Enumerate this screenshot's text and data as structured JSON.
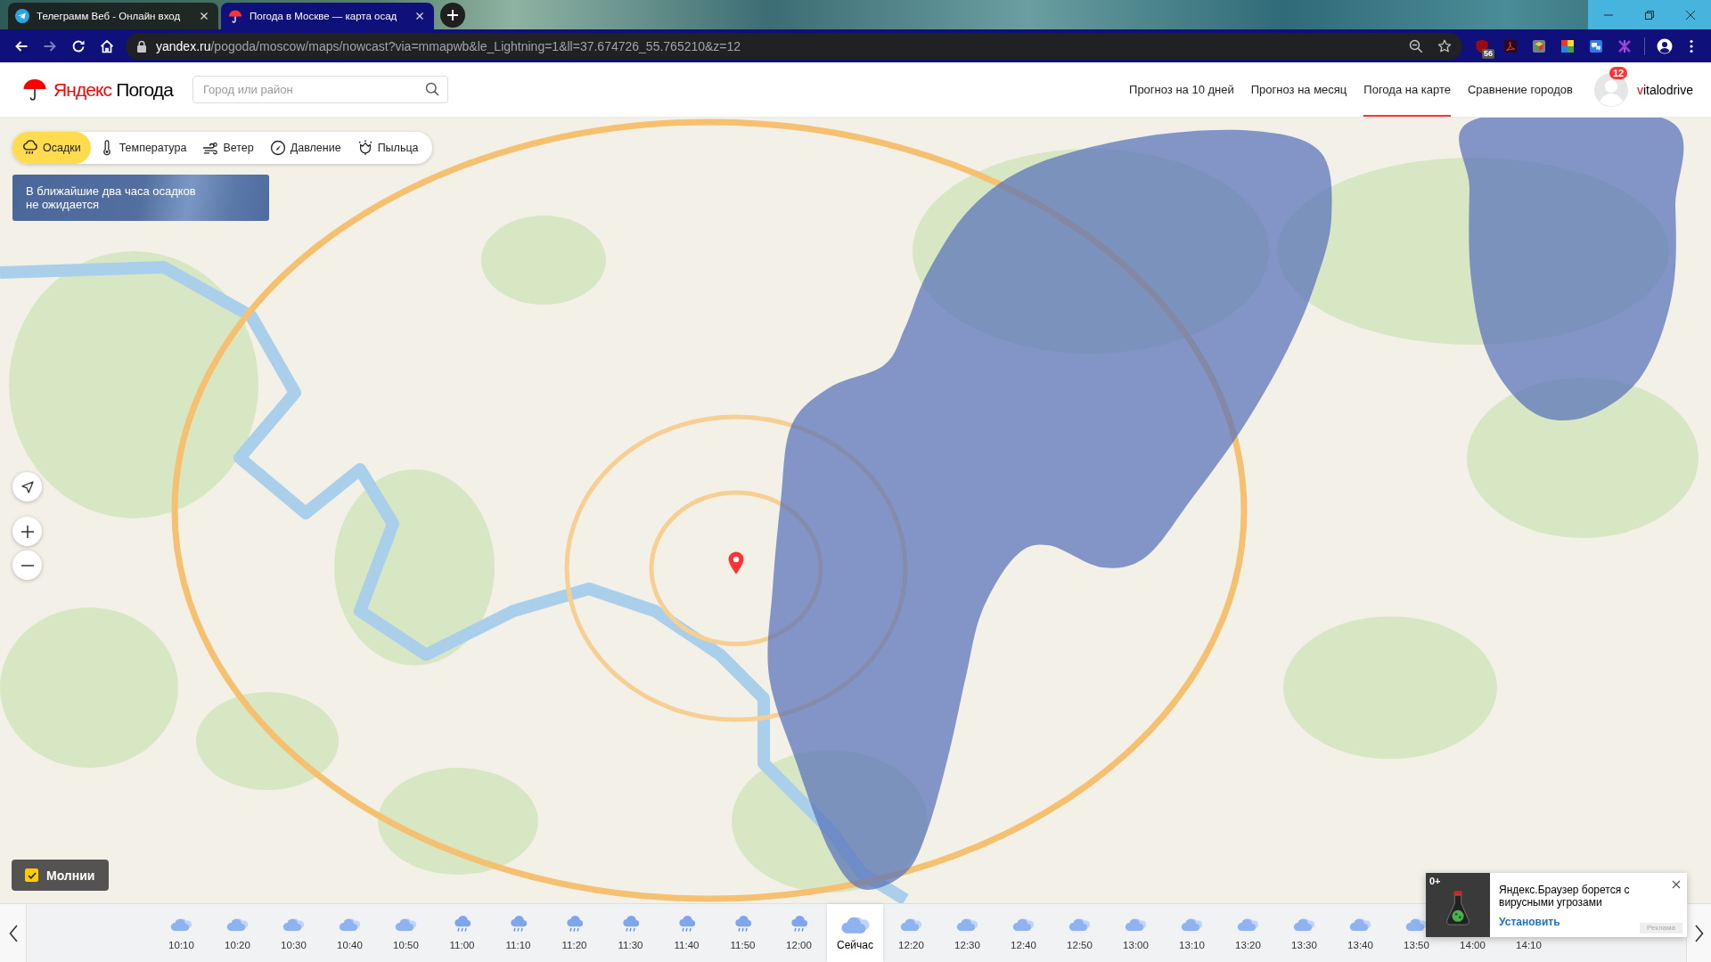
{
  "browser": {
    "tabs": [
      {
        "title": "Телеграмм Веб - Онлайн вход",
        "kind": "telegram",
        "selected": false
      },
      {
        "title": "Погода в Москве — карта осад",
        "kind": "umbrella",
        "selected": true
      }
    ],
    "nav_buttons": [
      {
        "kind": "back",
        "disabled": false
      },
      {
        "kind": "forward",
        "disabled": true
      },
      {
        "kind": "reload",
        "disabled": false
      },
      {
        "kind": "home",
        "disabled": false
      }
    ],
    "address": {
      "host": "yandex.ru",
      "path": "/pogoda/moscow/maps/nowcast?via=mmapwb&le_Lightning=1&ll=37.674726_55.765210&z=12"
    },
    "extensions": [
      {
        "kind": "shield",
        "badge": "56"
      },
      {
        "kind": "pdf"
      },
      {
        "kind": "cube"
      },
      {
        "kind": "squares"
      },
      {
        "kind": "translate"
      },
      {
        "kind": "cross"
      }
    ]
  },
  "header": {
    "logo": {
      "brand": "Яндекс",
      "product": "Погода"
    },
    "search": {
      "placeholder": "Город или район"
    },
    "nav": [
      {
        "label": "Прогноз на 10 дней",
        "selected": false
      },
      {
        "label": "Прогноз на месяц",
        "selected": false
      },
      {
        "label": "Погода на карте",
        "selected": true
      },
      {
        "label": "Сравнение городов",
        "selected": false
      }
    ],
    "user": {
      "name": "vitalodrive",
      "badge": "12"
    }
  },
  "map": {
    "layers": [
      {
        "label": "Осадки",
        "kind": "rain",
        "selected": true
      },
      {
        "label": "Температура",
        "kind": "thermometer",
        "selected": false
      },
      {
        "label": "Ветер",
        "kind": "wind",
        "selected": false
      },
      {
        "label": "Давление",
        "kind": "gauge",
        "selected": false
      },
      {
        "label": "Пыльца",
        "kind": "flower",
        "selected": false
      }
    ],
    "notice": "В ближайшие два часа осадков\nне ожидается",
    "lightning": {
      "label": "Молнии",
      "checked": true
    }
  },
  "timeline": {
    "slots": [
      {
        "time": "10:10",
        "kind": "cloud",
        "selected": false
      },
      {
        "time": "10:20",
        "kind": "cloud",
        "selected": false
      },
      {
        "time": "10:30",
        "kind": "cloud",
        "selected": false
      },
      {
        "time": "10:40",
        "kind": "cloud",
        "selected": false
      },
      {
        "time": "10:50",
        "kind": "cloud",
        "selected": false
      },
      {
        "time": "11:00",
        "kind": "rain",
        "selected": false
      },
      {
        "time": "11:10",
        "kind": "rain",
        "selected": false
      },
      {
        "time": "11:20",
        "kind": "rain",
        "selected": false
      },
      {
        "time": "11:30",
        "kind": "rain",
        "selected": false
      },
      {
        "time": "11:40",
        "kind": "rain",
        "selected": false
      },
      {
        "time": "11:50",
        "kind": "rain",
        "selected": false
      },
      {
        "time": "12:00",
        "kind": "rain",
        "selected": false
      },
      {
        "time": "Сейчас",
        "kind": "cloud",
        "selected": true
      },
      {
        "time": "12:20",
        "kind": "cloud",
        "selected": false
      },
      {
        "time": "12:30",
        "kind": "cloud",
        "selected": false
      },
      {
        "time": "12:40",
        "kind": "cloud",
        "selected": false
      },
      {
        "time": "12:50",
        "kind": "cloud",
        "selected": false
      },
      {
        "time": "13:00",
        "kind": "cloud",
        "selected": false
      },
      {
        "time": "13:10",
        "kind": "cloud",
        "selected": false
      },
      {
        "time": "13:20",
        "kind": "cloud",
        "selected": false
      },
      {
        "time": "13:30",
        "kind": "cloud",
        "selected": false
      },
      {
        "time": "13:40",
        "kind": "cloud",
        "selected": false
      },
      {
        "time": "13:50",
        "kind": "cloud",
        "selected": false
      },
      {
        "time": "14:00",
        "selected": false
      },
      {
        "time": "14:10",
        "selected": false
      }
    ]
  },
  "ad": {
    "age_rating": "0+",
    "text": "Яндекс.Браузер борется с вирусными угрозами",
    "action": "Установить",
    "label": "Реклама"
  }
}
